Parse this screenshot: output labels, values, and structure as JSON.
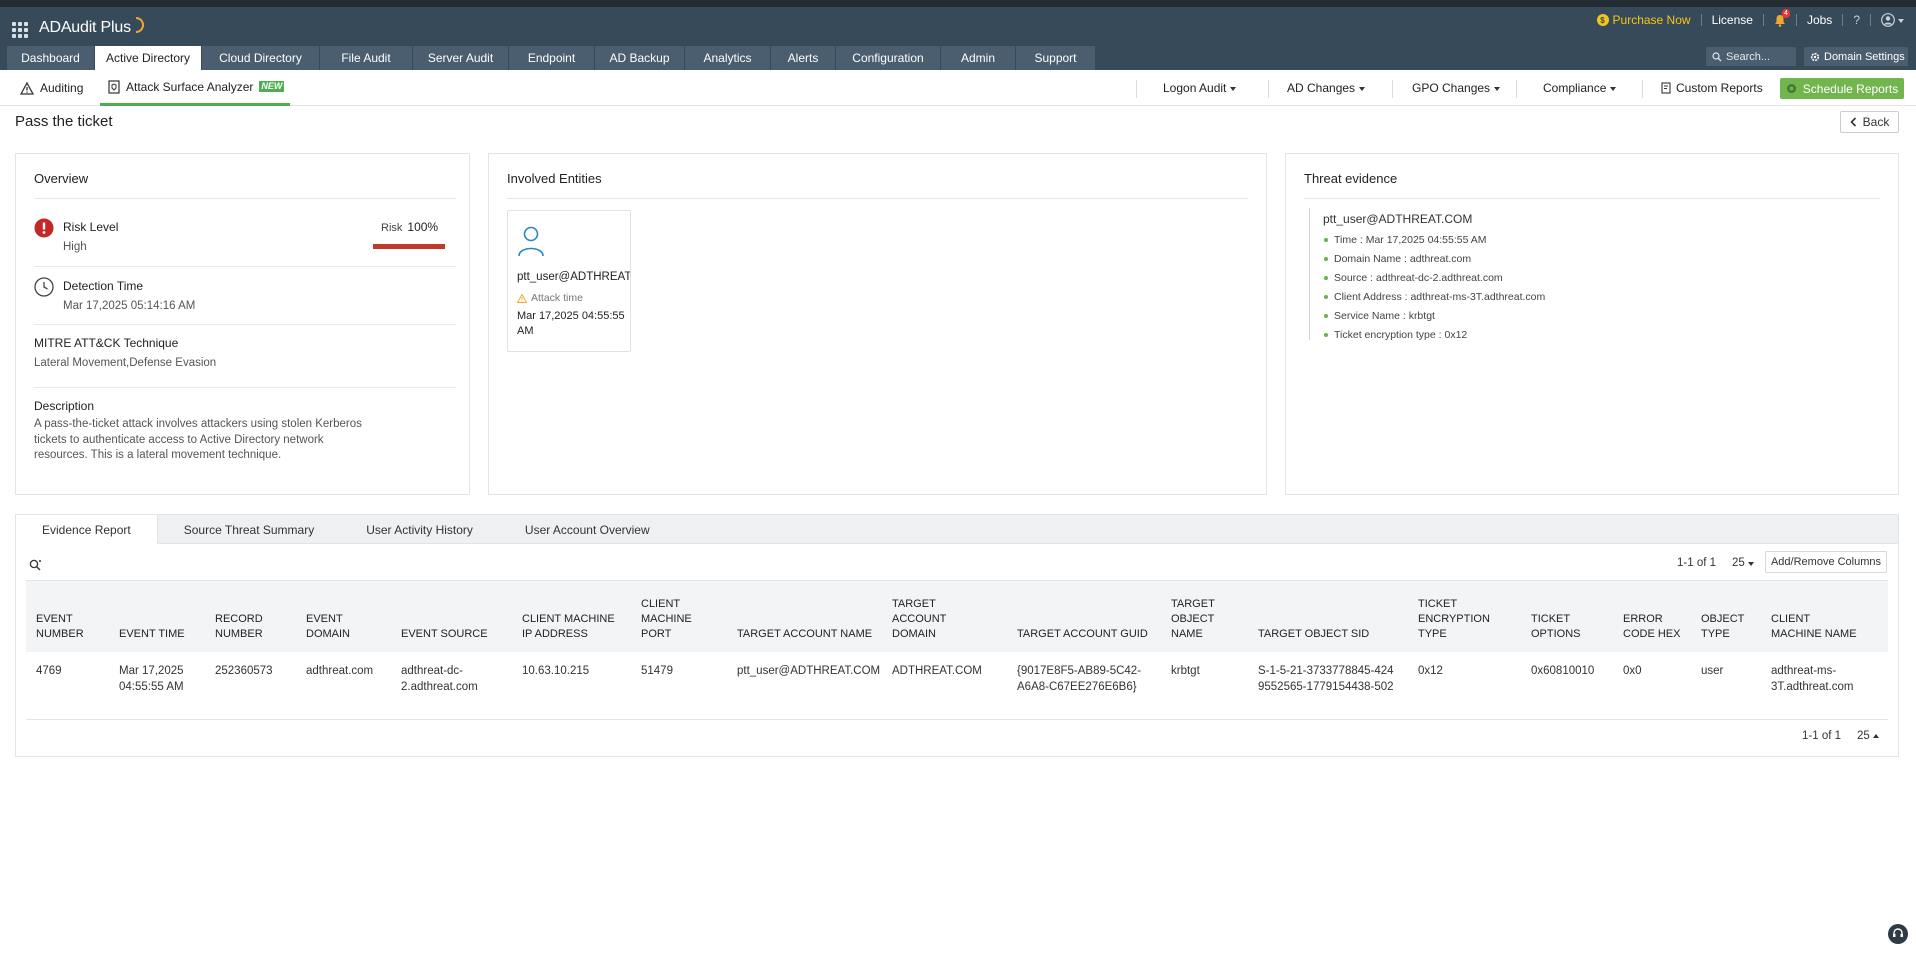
{
  "app": {
    "title": "ADAudit Plus"
  },
  "topbar": {
    "purchase": "Purchase Now",
    "license": "License",
    "alerts_count": "4",
    "jobs": "Jobs",
    "help": "?"
  },
  "nav": {
    "tabs": [
      "Dashboard",
      "Active Directory",
      "Cloud Directory",
      "File Audit",
      "Server Audit",
      "Endpoint",
      "AD Backup",
      "Analytics",
      "Alerts",
      "Configuration",
      "Admin",
      "Support"
    ],
    "active": "Active Directory",
    "search_placeholder": "Search...",
    "domain_settings": "Domain Settings"
  },
  "subnav": {
    "auditing": "Auditing",
    "attack_surface": "Attack Surface Analyzer",
    "new_badge": "NEW",
    "logon_audit": "Logon Audit",
    "ad_changes": "AD Changes",
    "gpo_changes": "GPO Changes",
    "compliance": "Compliance",
    "custom_reports": "Custom Reports",
    "schedule_reports": "Schedule Reports"
  },
  "page": {
    "title": "Pass the ticket",
    "back": "Back"
  },
  "overview": {
    "title": "Overview",
    "risk_label": "Risk Level",
    "risk_value": "High",
    "risk_word": "Risk",
    "risk_percent": "100%",
    "risk_fraction": 1.0,
    "detection_label": "Detection Time",
    "detection_value": "Mar 17,2025 05:14:16 AM",
    "mitre_label": "MITRE ATT&CK Technique",
    "mitre_value": "Lateral Movement,Defense Evasion",
    "description_label": "Description",
    "description_value": "A pass-the-ticket attack involves attackers using stolen Kerberos tickets to authenticate access to Active Directory network resources. This is a lateral movement technique."
  },
  "entities": {
    "title": "Involved Entities",
    "name": "ptt_user@ADTHREAT.COM",
    "attack_time_label": "Attack time",
    "attack_time": "Mar 17,2025 04:55:55 AM"
  },
  "evidence": {
    "title": "Threat evidence",
    "user": "ptt_user@ADTHREAT.COM",
    "items": [
      "Time : Mar 17,2025 04:55:55 AM",
      "Domain Name : adthreat.com",
      "Source : adthreat-dc-2.adthreat.com",
      "Client Address : adthreat-ms-3T.adthreat.com",
      "Service Name : krbtgt",
      "Ticket encryption type : 0x12"
    ]
  },
  "lower_tabs": [
    "Evidence Report",
    "Source Threat Summary",
    "User Activity History",
    "User Account Overview"
  ],
  "table": {
    "pager_text": "1-1 of 1",
    "page_size": "25",
    "add_remove": "Add/Remove Columns",
    "headers": [
      "EVENT NUMBER",
      "EVENT TIME",
      "RECORD NUMBER",
      "EVENT DOMAIN",
      "EVENT SOURCE",
      "CLIENT MACHINE IP ADDRESS",
      "CLIENT MACHINE PORT",
      "TARGET ACCOUNT NAME",
      "TARGET ACCOUNT DOMAIN",
      "TARGET ACCOUNT GUID",
      "TARGET OBJECT NAME",
      "TARGET OBJECT SID",
      "TICKET ENCRYPTION TYPE",
      "TICKET OPTIONS",
      "ERROR CODE HEX",
      "OBJECT TYPE",
      "CLIENT MACHINE NAME"
    ],
    "rows": [
      [
        "4769",
        "Mar 17,2025 04:55:55 AM",
        "252360573",
        "adthreat.com",
        "adthreat-dc-2.adthreat.com",
        "10.63.10.215",
        "51479",
        "ptt_user@ADTHREAT.COM",
        "ADTHREAT.COM",
        "{9017E8F5-AB89-5C42-A6A8-C67EE276E6B6}",
        "krbtgt",
        "S-1-5-21-3733778845-4249552565-1779154438-502",
        "0x12",
        "0x60810010",
        "0x0",
        "user",
        "adthreat-ms-3T.adthreat.com"
      ]
    ]
  },
  "colors": {
    "topbar": "#374a5a",
    "accent_green": "#72b54e",
    "risk_red": "#c0392b",
    "purchase_gold": "#f5c518"
  }
}
